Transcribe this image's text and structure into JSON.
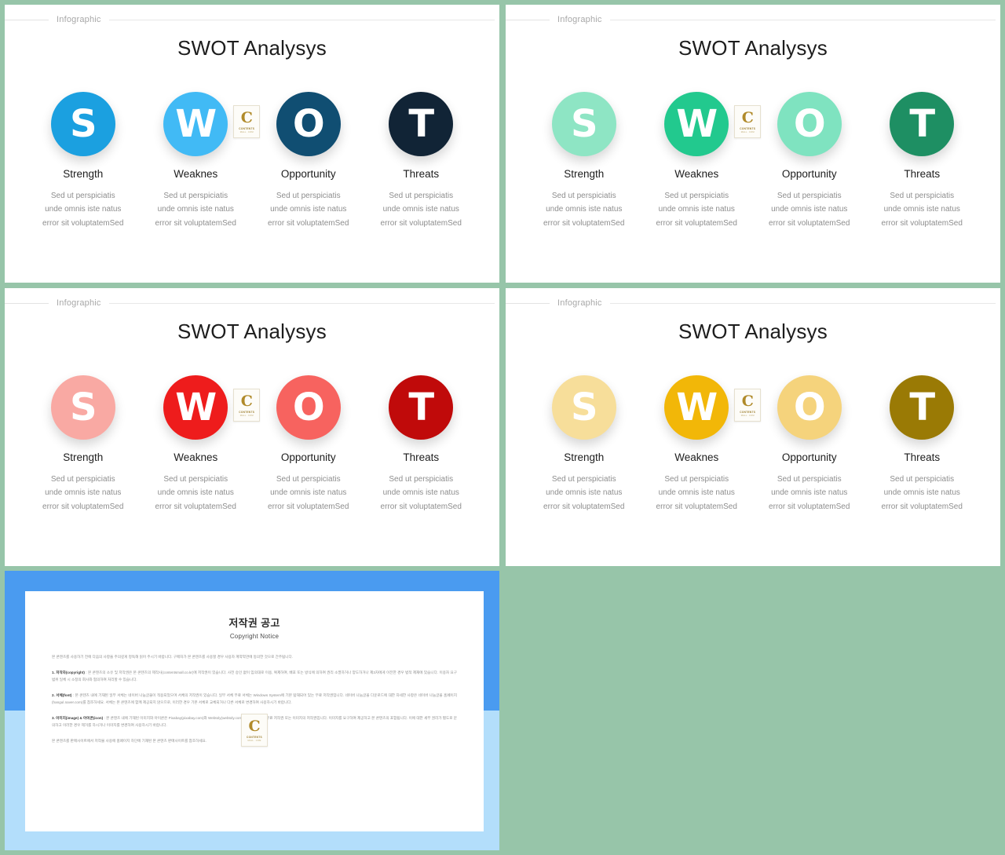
{
  "background_color": "#97c5a9",
  "slides": [
    {
      "id": "swot-blue",
      "header_label": "Infographic",
      "title": "SWOT Analysys",
      "items": [
        {
          "letter": "S",
          "label": "Strength",
          "color": "#1ba0e0",
          "desc_l1": "Sed ut perspiciatis",
          "desc_l2": "unde omnis iste natus",
          "desc_l3": "error sit voluptatemSed"
        },
        {
          "letter": "W",
          "label": "Weaknes",
          "color": "#41baf5",
          "desc_l1": "Sed ut perspiciatis",
          "desc_l2": "unde omnis iste natus",
          "desc_l3": "error sit voluptatemSed"
        },
        {
          "letter": "O",
          "label": "Opportunity",
          "color": "#104e72",
          "desc_l1": "Sed ut perspiciatis",
          "desc_l2": "unde omnis iste natus",
          "desc_l3": "error sit voluptatemSed"
        },
        {
          "letter": "T",
          "label": "Threats",
          "color": "#112436",
          "desc_l1": "Sed ut perspiciatis",
          "desc_l2": "unde omnis iste natus",
          "desc_l3": "error sit voluptatemSed"
        }
      ]
    },
    {
      "id": "swot-green",
      "header_label": "Infographic",
      "title": "SWOT Analysys",
      "items": [
        {
          "letter": "S",
          "label": "Strength",
          "color": "#8ee5c4",
          "desc_l1": "Sed ut perspiciatis",
          "desc_l2": "unde omnis iste natus",
          "desc_l3": "error sit voluptatemSed"
        },
        {
          "letter": "W",
          "label": "Weaknes",
          "color": "#22c98e",
          "desc_l1": "Sed ut perspiciatis",
          "desc_l2": "unde omnis iste natus",
          "desc_l3": "error sit voluptatemSed"
        },
        {
          "letter": "O",
          "label": "Opportunity",
          "color": "#7fe3c0",
          "desc_l1": "Sed ut perspiciatis",
          "desc_l2": "unde omnis iste natus",
          "desc_l3": "error sit voluptatemSed"
        },
        {
          "letter": "T",
          "label": "Threats",
          "color": "#1e8f63",
          "desc_l1": "Sed ut perspiciatis",
          "desc_l2": "unde omnis iste natus",
          "desc_l3": "error sit voluptatemSed"
        }
      ]
    },
    {
      "id": "swot-red",
      "header_label": "Infographic",
      "title": "SWOT Analysys",
      "items": [
        {
          "letter": "S",
          "label": "Strength",
          "color": "#f9a9a3",
          "desc_l1": "Sed ut perspiciatis",
          "desc_l2": "unde omnis iste natus",
          "desc_l3": "error sit voluptatemSed"
        },
        {
          "letter": "W",
          "label": "Weaknes",
          "color": "#ee1c1c",
          "desc_l1": "Sed ut perspiciatis",
          "desc_l2": "unde omnis iste natus",
          "desc_l3": "error sit voluptatemSed"
        },
        {
          "letter": "O",
          "label": "Opportunity",
          "color": "#f7635f",
          "desc_l1": "Sed ut perspiciatis",
          "desc_l2": "unde omnis iste natus",
          "desc_l3": "error sit voluptatemSed"
        },
        {
          "letter": "T",
          "label": "Threats",
          "color": "#c00a0a",
          "desc_l1": "Sed ut perspiciatis",
          "desc_l2": "unde omnis iste natus",
          "desc_l3": "error sit voluptatemSed"
        }
      ]
    },
    {
      "id": "swot-yellow",
      "header_label": "Infographic",
      "title": "SWOT Analysys",
      "items": [
        {
          "letter": "S",
          "label": "Strength",
          "color": "#f7de9a",
          "desc_l1": "Sed ut perspiciatis",
          "desc_l2": "unde omnis iste natus",
          "desc_l3": "error sit voluptatemSed"
        },
        {
          "letter": "W",
          "label": "Weaknes",
          "color": "#f2b708",
          "desc_l1": "Sed ut perspiciatis",
          "desc_l2": "unde omnis iste natus",
          "desc_l3": "error sit voluptatemSed"
        },
        {
          "letter": "O",
          "label": "Opportunity",
          "color": "#f5d37c",
          "desc_l1": "Sed ut perspiciatis",
          "desc_l2": "unde omnis iste natus",
          "desc_l3": "error sit voluptatemSed"
        },
        {
          "letter": "T",
          "label": "Threats",
          "color": "#9a7a05",
          "desc_l1": "Sed ut perspiciatis",
          "desc_l2": "unde omnis iste natus",
          "desc_l3": "error sit voluptatemSed"
        }
      ]
    }
  ],
  "watermark": {
    "letter": "C",
    "line1": "CONTENTS",
    "line2": "MALL . COM"
  },
  "copyright_slide": {
    "frame_color_upper": "#4a9bf0",
    "frame_color_lower": "#b3defb",
    "title_ko": "저작권 공고",
    "title_en": "Copyright Notice",
    "paragraphs": [
      "본 콘텐츠를 사용하기 전에 다음의 사항을 주의깊게 정독해 읽어 주시기 바랍니다. 구매자가 본 콘텐츠를 사용할 경우 사용자 계약약관에 동의한 것으로 간주됩니다.",
      "<b>1. 저작자(copyright)</b> : 본 콘텐츠의 소유 및 저작권은 본 콘텐츠의 제작사(contentsmall.co.kr)에 저작권이 있습니다. 사전 승인 없이 임의대로 이용, 복제하여, 배포 또는 방식에 의하여 권리 소멸하거나 양도하거나 제3자에게 이전한 경우 법적 제재에 있습니다. 이용자 요구 범위 일체 시 소정의 회사와 협의하여 처리할 수 있습니다.",
      "<b>2. 서체(font)</b> : 본 콘텐츠 내에 기재된 일부 서체는 네이버 나눔글꼴이 적용되었으며 서체의 저작권이 있습니다. 일부 서체 무료 서체는 Windows System에 기본 탑재되어 있는 무료 저작권입니다. 네이버 나눔글꼴 다운로드에 대한 자세한 사항은 네이버 나눔글꼴 홈페이지(hangul.naver.com)를 참조하세요. 서체는 본 콘텐츠에 함께 제공되지 않으므로, 이러한 경우 기본 서체로 교체되거나 다른 서체로 변경하여 사용하시기 바랍니다.",
      "<b>3. 이미지(image) &amp; 아이콘(icon)</b> : 본 콘텐츠 내에 기재된 이미지와 아이콘은 Pixabay(pixabay.com)와 Webtoly(webtoly.com) 등에서 제공한 무료 저작권 또는 이미지의 저작권입니다. 이미지를 요구하여 제공하고 본 콘텐츠의 포함됩니다. 이에 대한 세부 권리가 별도로 문의하고 이러한 경우 제거를 하시거나 이미지를 변경하여 사용하시기 바랍니다.",
      "본 콘텐츠를 판매사이트에서 저작물 사용에 홈페이지 하단에 기재된 본 콘텐츠 판매사이트를 참조하세요."
    ]
  }
}
